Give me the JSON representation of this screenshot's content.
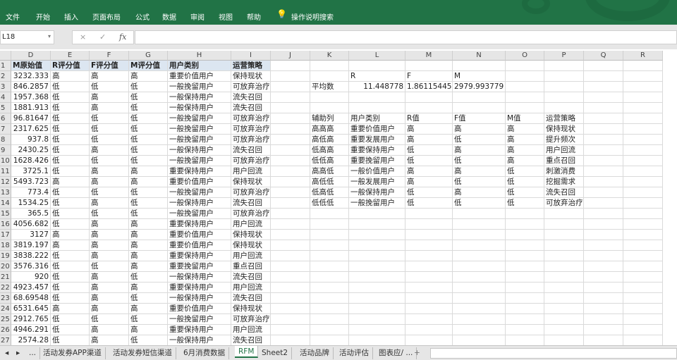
{
  "ribbon": {
    "menus": [
      "文件",
      "开始",
      "插入",
      "页面布局",
      "公式",
      "数据",
      "审阅",
      "视图",
      "帮助"
    ],
    "search": "操作说明搜索"
  },
  "formula_bar": {
    "name_box": "L18",
    "cancel": "×",
    "enter": "✓",
    "fx": "fx",
    "value": ""
  },
  "columns": [
    "D",
    "E",
    "F",
    "G",
    "H",
    "I",
    "J",
    "K",
    "L",
    "M",
    "N",
    "O",
    "P",
    "Q",
    "R"
  ],
  "header_row": [
    "M原始值",
    "R评分值",
    "F评分值",
    "M评分值",
    "用户类别",
    "运营策略"
  ],
  "rows": [
    [
      "3232.333",
      "高",
      "高",
      "高",
      "重要价值用户",
      "保持现状"
    ],
    [
      "846.2857",
      "低",
      "低",
      "低",
      "一般挽留用户",
      "可放弃治疗"
    ],
    [
      "1957.368",
      "低",
      "高",
      "低",
      "一般保持用户",
      "流失召回"
    ],
    [
      "1881.913",
      "低",
      "高",
      "低",
      "一般保持用户",
      "流失召回"
    ],
    [
      "96.81647",
      "低",
      "低",
      "低",
      "一般挽留用户",
      "可放弃治疗"
    ],
    [
      "2317.625",
      "低",
      "低",
      "低",
      "一般挽留用户",
      "可放弃治疗"
    ],
    [
      "937.8",
      "低",
      "低",
      "低",
      "一般挽留用户",
      "可放弃治疗"
    ],
    [
      "2430.25",
      "低",
      "高",
      "低",
      "一般保持用户",
      "流失召回"
    ],
    [
      "1628.426",
      "低",
      "低",
      "低",
      "一般挽留用户",
      "可放弃治疗"
    ],
    [
      "3725.1",
      "低",
      "高",
      "高",
      "重要保持用户",
      "用户回流"
    ],
    [
      "5493.723",
      "高",
      "高",
      "高",
      "重要价值用户",
      "保持现状"
    ],
    [
      "773.4",
      "低",
      "低",
      "低",
      "一般挽留用户",
      "可放弃治疗"
    ],
    [
      "1534.25",
      "低",
      "高",
      "低",
      "一般保持用户",
      "流失召回"
    ],
    [
      "365.5",
      "低",
      "低",
      "低",
      "一般挽留用户",
      "可放弃治疗"
    ],
    [
      "4056.682",
      "低",
      "高",
      "高",
      "重要保持用户",
      "用户回流"
    ],
    [
      "3127",
      "高",
      "高",
      "高",
      "重要价值用户",
      "保持现状"
    ],
    [
      "3819.197",
      "高",
      "高",
      "高",
      "重要价值用户",
      "保持现状"
    ],
    [
      "3838.222",
      "低",
      "高",
      "高",
      "重要保持用户",
      "用户回流"
    ],
    [
      "3576.316",
      "低",
      "低",
      "高",
      "重要挽留用户",
      "重点召回"
    ],
    [
      "920",
      "低",
      "高",
      "低",
      "一般保持用户",
      "流失召回"
    ],
    [
      "4923.457",
      "低",
      "高",
      "高",
      "重要保持用户",
      "用户回流"
    ],
    [
      "68.69548",
      "低",
      "高",
      "低",
      "一般保持用户",
      "流失召回"
    ],
    [
      "6531.645",
      "高",
      "高",
      "高",
      "重要价值用户",
      "保持现状"
    ],
    [
      "2912.765",
      "低",
      "低",
      "低",
      "一般挽留用户",
      "可放弃治疗"
    ],
    [
      "4946.291",
      "低",
      "高",
      "高",
      "重要保持用户",
      "用户回流"
    ],
    [
      "2574.28",
      "低",
      "高",
      "低",
      "一般保持用户",
      "流失召回"
    ]
  ],
  "averages": {
    "labels": [
      "R",
      "F",
      "M"
    ],
    "row_label": "平均数",
    "values": [
      "11.448778",
      "1.86115445",
      "2979.993779"
    ]
  },
  "lookup": {
    "headers": [
      "辅助列",
      "用户类别",
      "R值",
      "F值",
      "M值",
      "运营策略"
    ],
    "rows": [
      [
        "高高高",
        "重要价值用户",
        "高",
        "高",
        "高",
        "保持现状"
      ],
      [
        "高低高",
        "重要发展用户",
        "高",
        "低",
        "高",
        "提升频次"
      ],
      [
        "低高高",
        "重要保持用户",
        "低",
        "高",
        "高",
        "用户回流"
      ],
      [
        "低低高",
        "重要挽留用户",
        "低",
        "低",
        "高",
        "重点召回"
      ],
      [
        "高高低",
        "一般价值用户",
        "高",
        "高",
        "低",
        "刺激消费"
      ],
      [
        "高低低",
        "一般发展用户",
        "高",
        "低",
        "低",
        "挖掘需求"
      ],
      [
        "低高低",
        "一般保持用户",
        "低",
        "高",
        "低",
        "流失召回"
      ],
      [
        "低低低",
        "一般挽留用户",
        "低",
        "低",
        "低",
        "可放弃治疗"
      ]
    ]
  },
  "sheet_tabs": {
    "nav": [
      "◂",
      "▸",
      "..."
    ],
    "tabs": [
      "活动发券APP渠道",
      "活动发券短信渠道",
      "6月消费数据",
      "RFM",
      "Sheet2",
      "活动品牌",
      "活动评估",
      "图表应/ ..."
    ],
    "active": "RFM",
    "add": "+"
  },
  "colors": {
    "accent": "#217346",
    "header_fill": "#dce6f1"
  }
}
